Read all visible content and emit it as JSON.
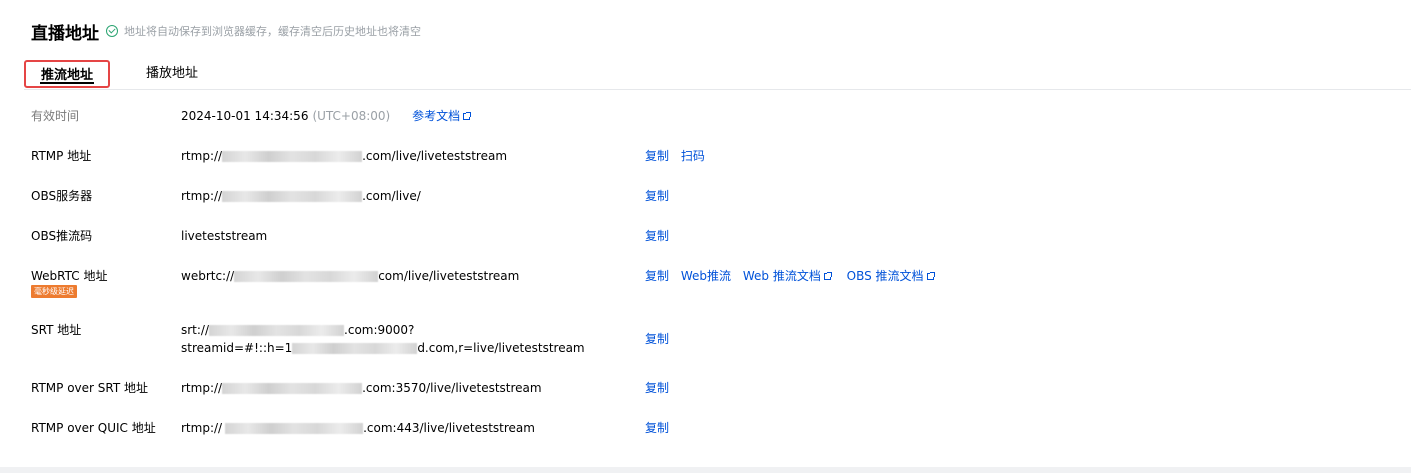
{
  "header": {
    "title": "直播地址",
    "hint": "地址将自动保存到浏览器缓存，缓存清空后历史地址也将清空"
  },
  "tabs": [
    {
      "label": "推流地址",
      "active": true
    },
    {
      "label": "播放地址",
      "active": false
    }
  ],
  "rows": {
    "expire": {
      "label": "有效时间",
      "value": "2024-10-01 14:34:56",
      "tz": "(UTC+08:00)",
      "doc": "参考文档"
    },
    "rtmp": {
      "label": "RTMP 地址",
      "prefix": "rtmp://",
      "suffix": ".com/live/liveteststream",
      "copy": "复制",
      "scan": "扫码"
    },
    "obs_server": {
      "label": "OBS服务器",
      "prefix": "rtmp://",
      "suffix": ".com/live/",
      "copy": "复制"
    },
    "obs_key": {
      "label": "OBS推流码",
      "value": "liveteststream",
      "copy": "复制"
    },
    "webrtc": {
      "label": "WebRTC 地址",
      "badge": "毫秒级延迟",
      "prefix": "webrtc://",
      "suffix": "com/live/liveteststream",
      "copy": "复制",
      "web_push": "Web推流",
      "web_doc": "Web 推流文档",
      "obs_doc": "OBS 推流文档"
    },
    "srt": {
      "label": "SRT 地址",
      "line1_prefix": "srt://",
      "line1_suffix": ".com:9000?",
      "line2_prefix": "streamid=#!::h=1",
      "line2_suffix": "d.com,r=live/liveteststream",
      "copy": "复制"
    },
    "rtmp_srt": {
      "label": "RTMP over SRT 地址",
      "prefix": "rtmp://",
      "suffix": ".com:3570/live/liveteststream",
      "copy": "复制"
    },
    "rtmp_quic": {
      "label": "RTMP over QUIC 地址",
      "prefix": "rtmp://",
      "suffix": ".com:443/live/liveteststream",
      "copy": "复制"
    }
  },
  "colors": {
    "link": "#0052d9",
    "badge": "#ed7b2f",
    "success": "#2ba471",
    "active_tab_border": "#e54545"
  }
}
